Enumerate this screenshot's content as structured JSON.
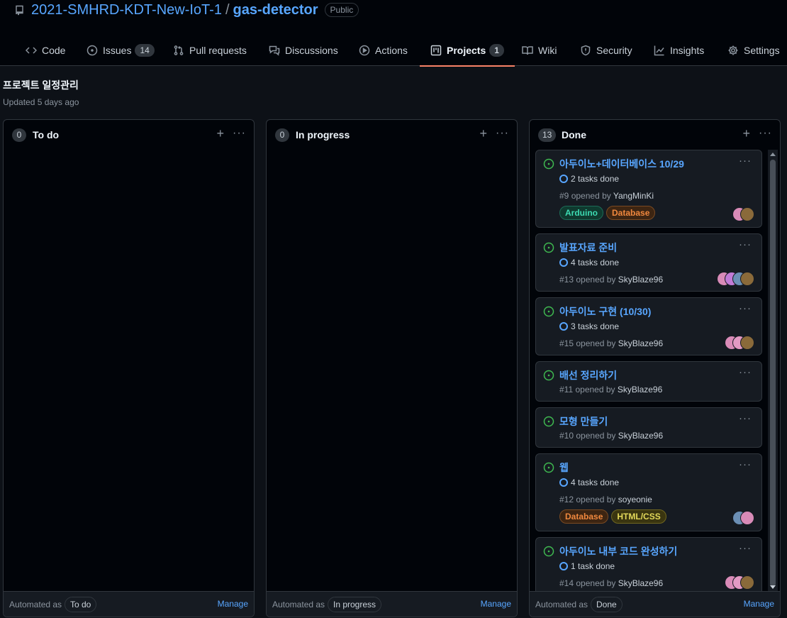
{
  "repo": {
    "owner": "2021-SMHRD-KDT-New-IoT-1",
    "slash": "/",
    "name": "gas-detector",
    "visibility": "Public"
  },
  "tabs": [
    {
      "label": "Code",
      "icon": "code-icon"
    },
    {
      "label": "Issues",
      "icon": "issue-opened-icon",
      "count": "14"
    },
    {
      "label": "Pull requests",
      "icon": "git-pull-request-icon"
    },
    {
      "label": "Discussions",
      "icon": "comment-discussion-icon"
    },
    {
      "label": "Actions",
      "icon": "play-icon"
    },
    {
      "label": "Projects",
      "icon": "project-icon",
      "count": "1",
      "active": true
    },
    {
      "label": "Wiki",
      "icon": "book-icon"
    },
    {
      "label": "Security",
      "icon": "shield-icon"
    },
    {
      "label": "Insights",
      "icon": "graph-icon"
    },
    {
      "label": "Settings",
      "icon": "gear-icon"
    }
  ],
  "project": {
    "title": "프로젝트 일정관리",
    "updated": "Updated 5 days ago"
  },
  "columns": [
    {
      "name": "To do",
      "count": "0",
      "add": "+",
      "more": "···",
      "automated_label": "Automated as",
      "automated_value": "To do",
      "manage": "Manage"
    },
    {
      "name": "In progress",
      "count": "0",
      "add": "+",
      "more": "···",
      "automated_label": "Automated as",
      "automated_value": "In progress",
      "manage": "Manage"
    },
    {
      "name": "Done",
      "count": "13",
      "add": "+",
      "more": "···",
      "automated_label": "Automated as",
      "automated_value": "Done",
      "manage": "Manage"
    }
  ],
  "cards": [
    {
      "title": "아두이노+데이터베이스 10/29",
      "tasks": "2 tasks done",
      "number": "#9",
      "opened_by": "opened by",
      "author": "YangMinKi",
      "labels": [
        "Arduino",
        "Database"
      ]
    },
    {
      "title": "발표자료 준비",
      "tasks": "4 tasks done",
      "number": "#13",
      "opened_by": "opened by",
      "author": "SkyBlaze96",
      "labels": []
    },
    {
      "title": "아두이노 구현 (10/30)",
      "tasks": "3 tasks done",
      "number": "#15",
      "opened_by": "opened by",
      "author": "SkyBlaze96",
      "labels": []
    },
    {
      "title": "배선 정리하기",
      "tasks": "",
      "number": "#11",
      "opened_by": "opened by",
      "author": "SkyBlaze96",
      "labels": []
    },
    {
      "title": "모형 만들기",
      "tasks": "",
      "number": "#10",
      "opened_by": "opened by",
      "author": "SkyBlaze96",
      "labels": []
    },
    {
      "title": "웹",
      "tasks": "4 tasks done",
      "number": "#12",
      "opened_by": "opened by",
      "author": "soyeonie",
      "labels": [
        "Database",
        "HTML/CSS"
      ]
    },
    {
      "title": "아두이노 내부 코드 완성하기",
      "tasks": "1 task done",
      "number": "#14",
      "opened_by": "opened by",
      "author": "SkyBlaze96",
      "labels": []
    }
  ],
  "card_more": "···",
  "colors": {
    "accent_link": "#58a6ff",
    "tab_underline": "#f78166",
    "issue_open": "#3fb950",
    "label_arduino_fg": "#3ddbb2",
    "label_database_fg": "#f0883e",
    "label_htmlcss_fg": "#e3d95a"
  }
}
